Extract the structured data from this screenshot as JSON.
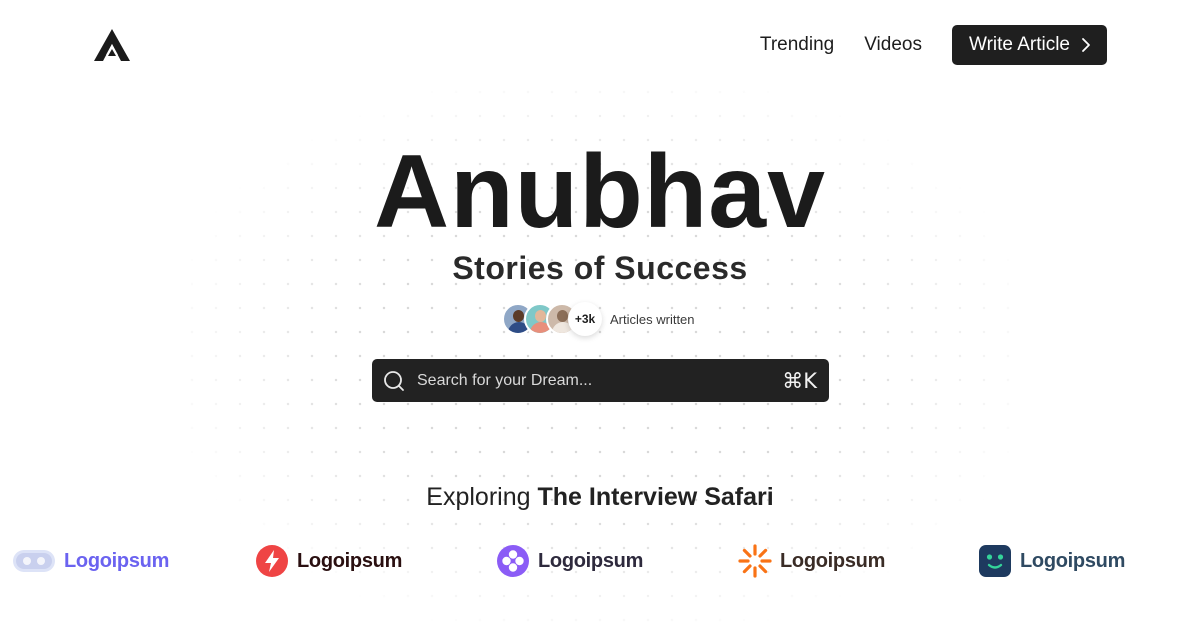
{
  "header": {
    "nav": {
      "trending": "Trending",
      "videos": "Videos"
    },
    "cta_label": "Write Article"
  },
  "hero": {
    "title": "Anubhav",
    "subtitle": "Stories of Success",
    "articles_count": "+3k",
    "articles_label": "Articles written"
  },
  "search": {
    "placeholder": "Search for your Dream...",
    "shortcut": "⌘K"
  },
  "section": {
    "title_prefix": "Exploring",
    "title_emphasis": "The Interview Safari"
  },
  "brands": [
    {
      "name": "Logoipsum",
      "icon": "toggle-logo-icon",
      "color": "#6b63f0"
    },
    {
      "name": "Logoipsum",
      "icon": "lightning-logo-icon",
      "color": "#2a0f10"
    },
    {
      "name": "Logoipsum",
      "icon": "flower-logo-icon",
      "color": "#2e2a3d"
    },
    {
      "name": "Logoipsum",
      "icon": "sunburst-logo-icon",
      "color": "#3a2c26"
    },
    {
      "name": "Logoipsum",
      "icon": "smiley-logo-icon",
      "color": "#2f4a62"
    }
  ],
  "colors": {
    "primary_dark": "#1f1f1f",
    "search_bg": "#222222",
    "brand_purple": "#8b5cf6",
    "brand_red": "#ef4444",
    "brand_orange": "#f97316",
    "brand_navy": "#1e3a5f"
  }
}
